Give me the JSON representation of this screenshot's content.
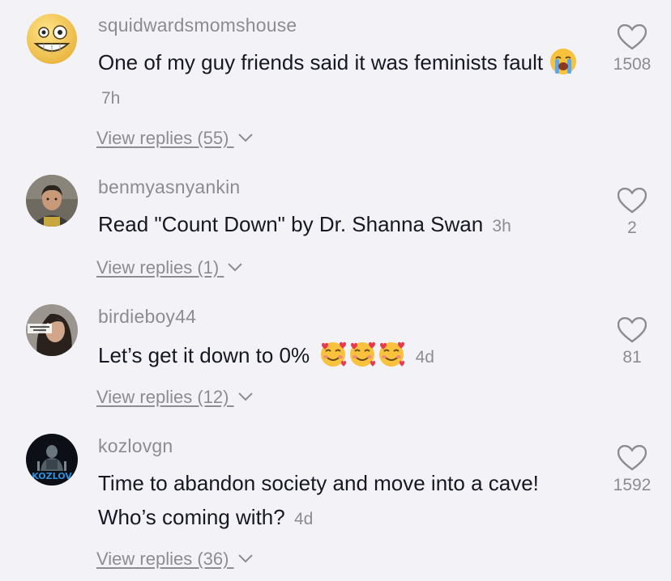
{
  "comments": [
    {
      "username": "squidwardsmomshouse",
      "avatar_icon": "grinning-face-emoji-avatar",
      "text": "One of my guy friends said it was feminists fault",
      "emoji": "loudly-crying-face",
      "time": "7h",
      "replies": "View replies (55)",
      "likes": "1508"
    },
    {
      "username": "benmyasnyankin",
      "avatar_icon": "man-photo-avatar",
      "text": "Read \"Count Down\" by Dr. Shanna Swan",
      "time": "3h",
      "replies": "View replies (1)",
      "likes": "2"
    },
    {
      "username": "birdieboy44",
      "avatar_icon": "woman-photo-avatar",
      "text": "Let’s get it down to 0%",
      "emoji": "smiling-face-with-hearts",
      "time": "4d",
      "replies": "View replies (12)",
      "likes": "81"
    },
    {
      "username": "kozlovgn",
      "avatar_icon": "kozlov-logo-avatar",
      "avatar_text": "KOZLOV",
      "text": "Time to abandon society and move into a cave! Who’s coming with?",
      "time": "4d",
      "replies": "View replies (36)",
      "likes": "1592"
    }
  ],
  "colors": {
    "background": "#f3f2f7",
    "primary_text": "#161823",
    "secondary_text": "#8c8c92"
  }
}
